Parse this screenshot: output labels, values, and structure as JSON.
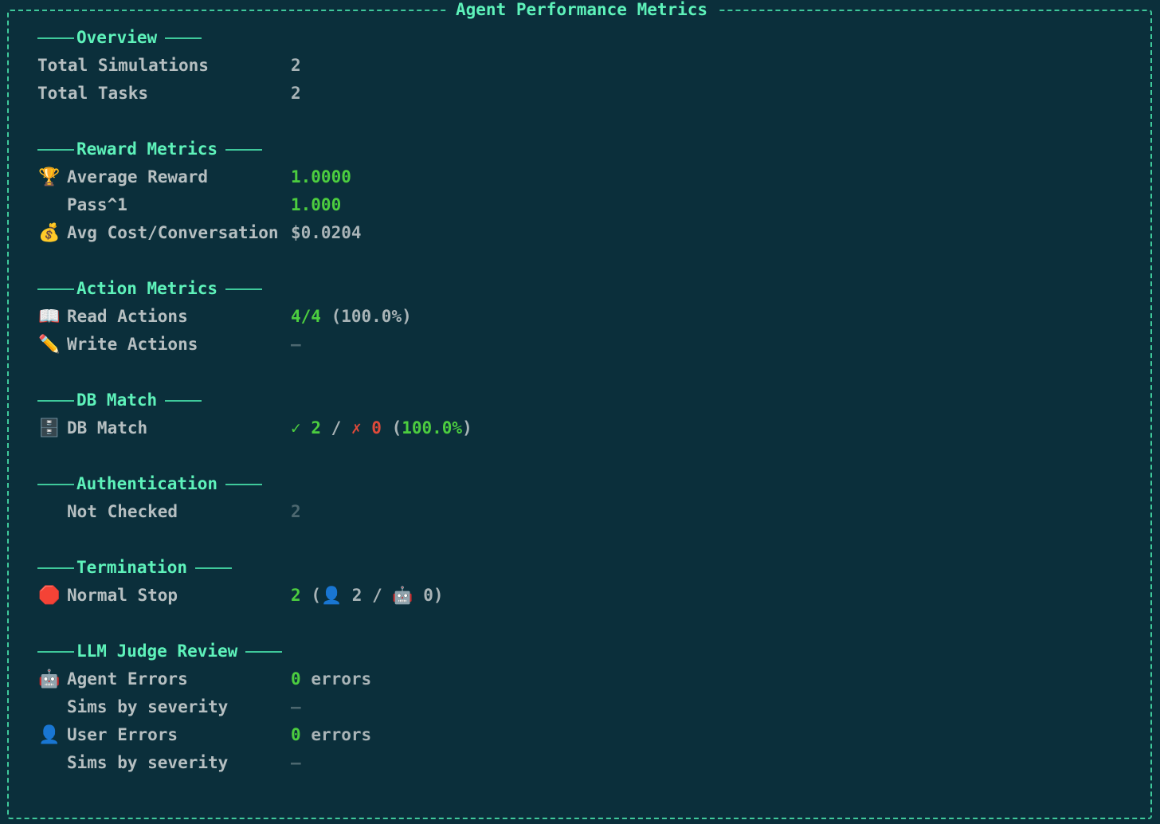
{
  "title": "Agent Performance Metrics",
  "overview": {
    "header": "Overview",
    "total_simulations_label": "Total Simulations",
    "total_simulations_value": "2",
    "total_tasks_label": "Total Tasks",
    "total_tasks_value": "2"
  },
  "reward": {
    "header": "Reward Metrics",
    "avg_reward_label": "Average Reward",
    "avg_reward_value": "1.0000",
    "pass_label": "Pass^1",
    "pass_value": "1.000",
    "avg_cost_label": "Avg Cost/Conversation",
    "avg_cost_value": "$0.0204"
  },
  "action": {
    "header": "Action Metrics",
    "read_label": "Read Actions",
    "read_value": "4/4",
    "read_pct": "(100.0%)",
    "write_label": "Write Actions",
    "write_value": "–"
  },
  "db": {
    "header": "DB Match",
    "label": "DB Match",
    "check_mark": "✓",
    "pass_count": "2",
    "separator": "/",
    "cross_mark": "✗",
    "fail_count": "0",
    "pct_open": "(",
    "pct": "100.0%",
    "pct_close": ")"
  },
  "auth": {
    "header": "Authentication",
    "not_checked_label": "Not Checked",
    "not_checked_value": "2"
  },
  "termination": {
    "header": "Termination",
    "normal_stop_label": "Normal Stop",
    "normal_stop_value": "2",
    "paren_open": "(",
    "user_count": "2",
    "separator": "/",
    "agent_count": "0",
    "paren_close": ")"
  },
  "judge": {
    "header": "LLM Judge Review",
    "agent_errors_label": "Agent Errors",
    "agent_errors_count": "0",
    "agent_errors_unit": "errors",
    "agent_sims_label": "Sims by severity",
    "agent_sims_value": "–",
    "user_errors_label": "User Errors",
    "user_errors_count": "0",
    "user_errors_unit": "errors",
    "user_sims_label": "Sims by severity",
    "user_sims_value": "–"
  },
  "icons": {
    "trophy": "🏆",
    "money_bag": "💰",
    "book": "📖",
    "pencil": "✏️",
    "cabinet": "🗄️",
    "stop_sign": "🛑",
    "user": "👤",
    "robot": "🤖"
  },
  "colors": {
    "background": "#0b2f3b",
    "accent": "#5ef2ba",
    "success": "#4ccd3f",
    "error": "#e04a3a",
    "text": "#b6bfc1",
    "dim": "#4d6870"
  }
}
